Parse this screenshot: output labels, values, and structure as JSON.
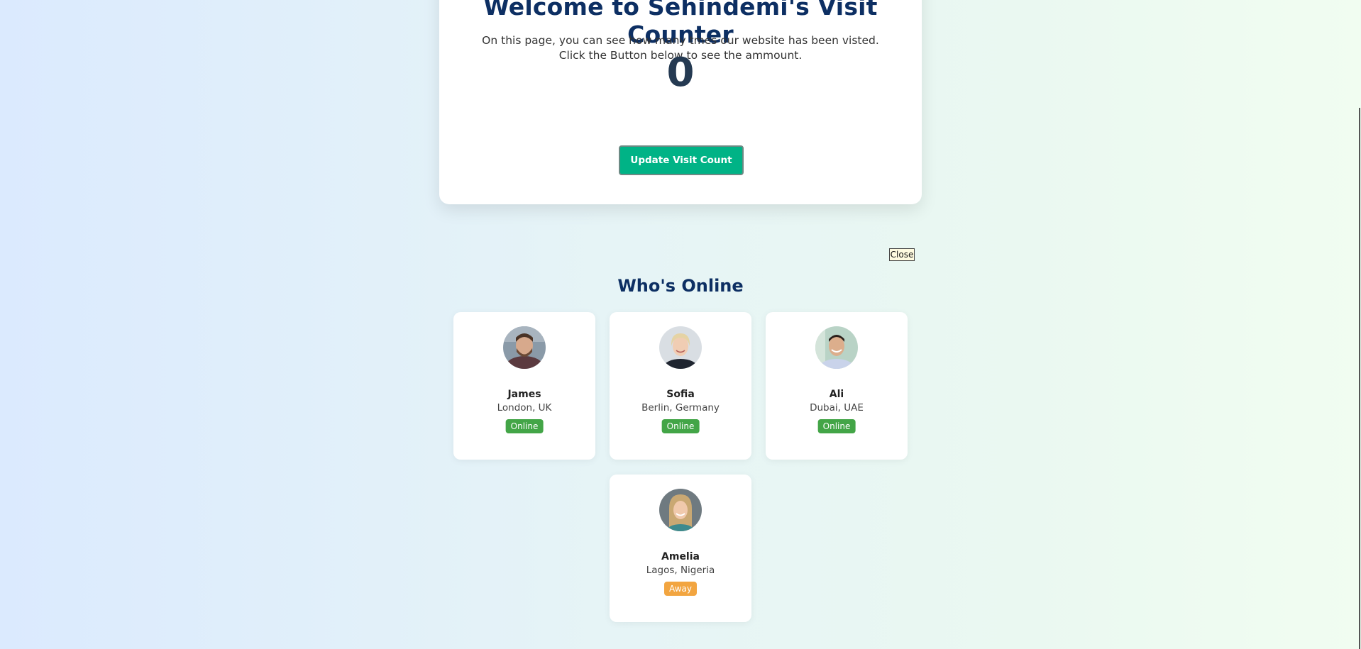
{
  "counter": {
    "title": "Welcome to Sehindemi's Visit Counter",
    "description": "On this page, you can see how many tmes our website has been visted. Click the Button below to see the ammount.",
    "count": "0",
    "button_label": "Update Visit Count"
  },
  "close_label": "Close",
  "online": {
    "title": "Who's Online",
    "users": [
      {
        "name": "James",
        "location": "London, UK",
        "status": "Online",
        "avatar": "man-beard-avatar"
      },
      {
        "name": "Sofia",
        "location": "Berlin, Germany",
        "status": "Online",
        "avatar": "woman-blonde-avatar"
      },
      {
        "name": "Ali",
        "location": "Dubai, UAE",
        "status": "Online",
        "avatar": "man-smiling-avatar"
      },
      {
        "name": "Amelia",
        "location": "Lagos, Nigeria",
        "status": "Away",
        "avatar": "woman-long-hair-avatar"
      }
    ]
  },
  "colors": {
    "title": "#0d2f63",
    "button": "#00b386",
    "online": "#43a547",
    "away": "#f2a540"
  }
}
